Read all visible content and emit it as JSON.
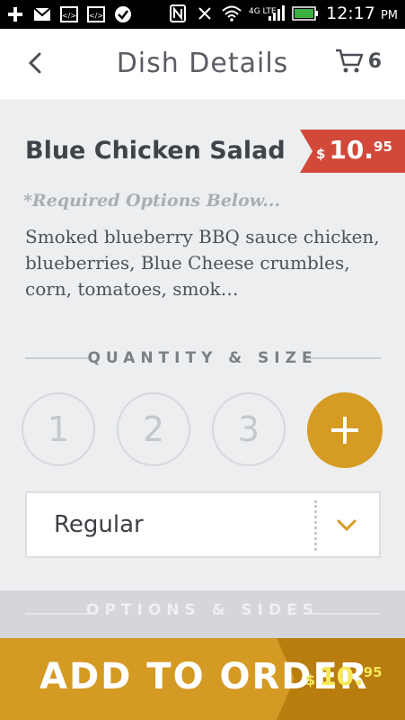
{
  "status_bar": {
    "time": "12:17",
    "ampm": "PM",
    "network": "4G LTE",
    "icons": [
      "plus-icon",
      "gmail-icon",
      "code-icon",
      "code-icon",
      "check-icon",
      "nfc-icon",
      "mute-icon",
      "wifi-icon",
      "signal-icon",
      "battery-icon"
    ]
  },
  "header": {
    "title": "Dish Details",
    "cart_count": "6"
  },
  "dish": {
    "name": "Blue Chicken Salad",
    "price_currency": "$",
    "price_whole": "10.",
    "price_cents": "95",
    "required_note": "*Required Options Below...",
    "description": "Smoked blueberry BBQ sauce chicken, blueberries, Blue Cheese crumbles, corn, tomatoes, smok…"
  },
  "quantity_section": {
    "label": "QUANTITY & SIZE",
    "options": [
      "1",
      "2",
      "3"
    ],
    "add_symbol": "+"
  },
  "size": {
    "selected": "Regular"
  },
  "options_section": {
    "label": "OPTIONS & SIDES"
  },
  "add_to_order": {
    "label": "ADD TO ORDER",
    "currency": "$",
    "price_whole": "10.",
    "price_cents": "95"
  },
  "colors": {
    "accent": "#d69b22",
    "price_tag": "#d2493a",
    "price_highlight": "#f7e85a",
    "background": "#eceef0"
  }
}
